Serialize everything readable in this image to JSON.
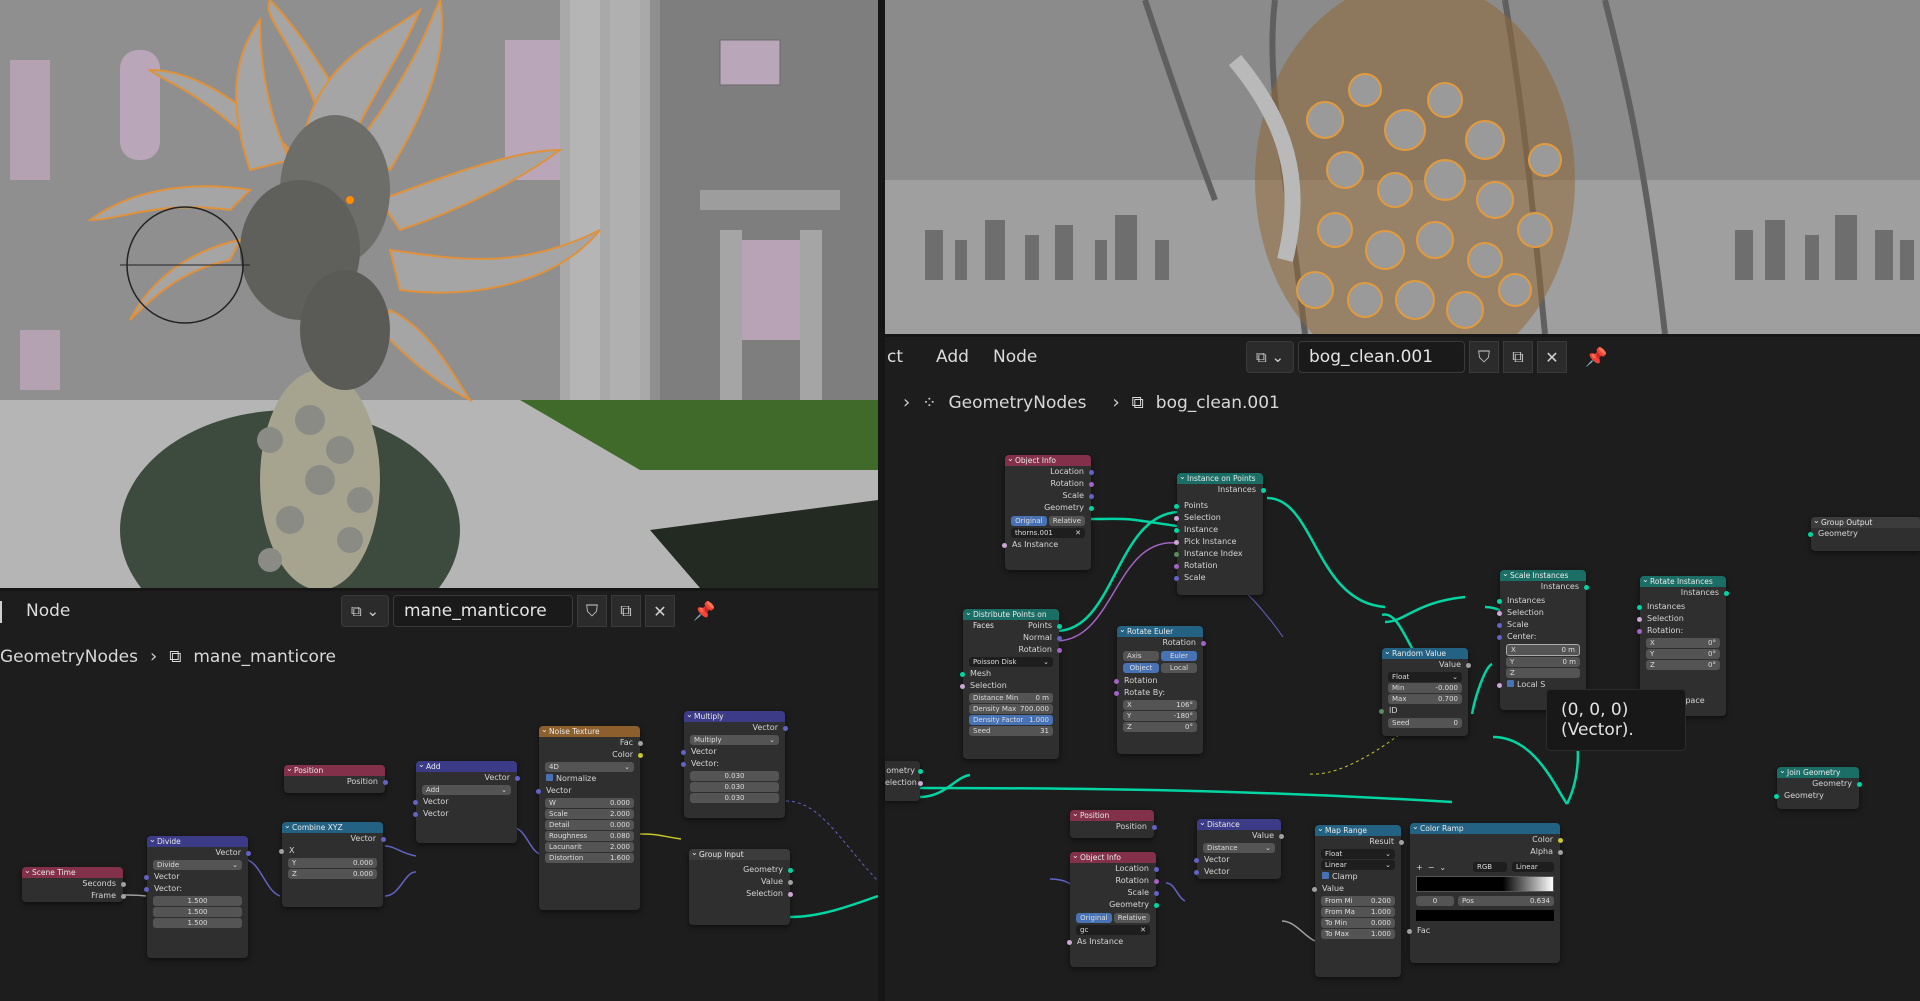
{
  "left_editor": {
    "menu": {
      "node": "Node"
    },
    "datablock": {
      "type_icon": "node-tree-icon",
      "name": "mane_manticore"
    },
    "breadcrumb": {
      "modifier": "GeometryNodes",
      "tree": "mane_manticore"
    },
    "nodes": {
      "scene_time": {
        "title": "Scene Time",
        "seconds": "Seconds",
        "frame": "Frame"
      },
      "divide": {
        "title": "Divide",
        "out": "Vector",
        "mode": "Divide",
        "in1": "Vector",
        "in2": "Vector:",
        "v": [
          "1.500",
          "1.500",
          "1.500"
        ]
      },
      "combine": {
        "title": "Combine XYZ",
        "out": "Vector",
        "x": "X",
        "y": "Y",
        "y_val": "0.000",
        "z": "Z",
        "z_val": "0.000"
      },
      "position": {
        "title": "Position",
        "out": "Position"
      },
      "add": {
        "title": "Add",
        "out": "Vector",
        "mode": "Add",
        "in1": "Vector",
        "in2": "Vector"
      },
      "noise": {
        "title": "Noise Texture",
        "fac": "Fac",
        "color": "Color",
        "dim": "4D",
        "normalize": "Normalize",
        "vector": "Vector",
        "w": "W",
        "w_val": "0.000",
        "scale": "Scale",
        "scale_val": "2.000",
        "detail": "Detail",
        "detail_val": "0.000",
        "rough": "Roughness",
        "rough_val": "0.080",
        "lac": "Lacunarit",
        "lac_val": "2.000",
        "dist": "Distortion",
        "dist_val": "1.600"
      },
      "multiply": {
        "title": "Multiply",
        "out": "Vector",
        "mode": "Multiply",
        "in1": "Vector",
        "in2": "Vector:",
        "v": [
          "0.030",
          "0.030",
          "0.030"
        ]
      },
      "group_input": {
        "title": "Group Input",
        "geometry": "Geometry",
        "value": "Value",
        "selection": "Selection"
      }
    }
  },
  "right_editor": {
    "menu": {
      "partial": "ct",
      "add": "Add",
      "node": "Node"
    },
    "datablock": {
      "type_icon": "node-tree-icon",
      "name": "bog_clean.001"
    },
    "breadcrumb": {
      "modifier": "GeometryNodes",
      "tree": "bog_clean.001"
    },
    "tooltip": "(0, 0, 0) (Vector).",
    "nodes": {
      "object_info": {
        "title": "Object Info",
        "location": "Location",
        "rotation": "Rotation",
        "scale": "Scale",
        "geometry": "Geometry",
        "original": "Original",
        "relative": "Relative",
        "object": "thorns.001",
        "as_instance": "As Instance"
      },
      "instance_on_points": {
        "title": "Instance on Points",
        "instances": "Instances",
        "points": "Points",
        "selection": "Selection",
        "instance": "Instance",
        "pick": "Pick Instance",
        "index": "Instance Index",
        "rotation": "Rotation",
        "scale": "Scale"
      },
      "distribute": {
        "title": "Distribute Points on Faces",
        "points": "Points",
        "normal": "Normal",
        "rotation": "Rotation",
        "mode": "Poisson Disk",
        "mesh": "Mesh",
        "selection": "Selection",
        "dist_min": "Distance Min",
        "dist_min_val": "0 m",
        "dens_max": "Density Max",
        "dens_max_val": "700.000",
        "dens_fac": "Density Factor",
        "dens_fac_val": "1.000",
        "seed": "Seed",
        "seed_val": "31"
      },
      "rotate_euler": {
        "title": "Rotate Euler",
        "rotation": "Rotation",
        "axis": "Axis An...",
        "euler": "Euler",
        "object": "Object",
        "local": "Local",
        "rot_in": "Rotation",
        "rot_by": "Rotate By:",
        "x": "X",
        "x_val": "106°",
        "y": "Y",
        "y_val": "-180°",
        "z": "Z",
        "z_val": "0°"
      },
      "scale_instances": {
        "title": "Scale Instances",
        "instances_out": "Instances",
        "instances": "Instances",
        "selection": "Selection",
        "scale": "Scale",
        "center": "Center:",
        "x": "X",
        "x_val": "0 m",
        "y": "Y",
        "y_val": "0 m",
        "z": "Z",
        "local": "Local S"
      },
      "rotate_instances": {
        "title": "Rotate Instances",
        "instances_out": "Instances",
        "instances": "Instances",
        "selection": "Selection",
        "rotation": "Rotation:",
        "x": "X",
        "x_val": "0°",
        "y": "Y",
        "y_val": "0°",
        "z": "Z",
        "z_val": "0°",
        "local": "Local Space"
      },
      "random_value": {
        "title": "Random Value",
        "value": "Value",
        "type": "Float",
        "min": "Min",
        "min_val": "-0.000",
        "max": "Max",
        "max_val": "0.700",
        "id": "ID",
        "seed": "Seed",
        "seed_val": "0"
      },
      "group_output": {
        "title": "Group Output",
        "geometry": "Geometry"
      },
      "join_geometry": {
        "title": "Join Geometry",
        "geometry_out": "Geometry",
        "geometry": "Geometry"
      },
      "position": {
        "title": "Position",
        "out": "Position"
      },
      "distance": {
        "title": "Distance",
        "value": "Value",
        "mode": "Distance",
        "in1": "Vector",
        "in2": "Vector"
      },
      "object_info2": {
        "title": "Object Info",
        "location": "Location",
        "rotation": "Rotation",
        "scale": "Scale",
        "geometry": "Geometry",
        "original": "Original",
        "relative": "Relative",
        "object": "gc",
        "as_instance": "As Instance"
      },
      "map_range": {
        "title": "Map Range",
        "result": "Result",
        "type": "Float",
        "interp": "Linear",
        "clamp": "Clamp",
        "value": "Value",
        "from_min": "From Mi",
        "from_min_val": "0.200",
        "from_max": "From Ma",
        "from_max_val": "1.000",
        "to_min": "To Min",
        "to_min_val": "0.000",
        "to_max": "To Max",
        "to_max_val": "1.000"
      },
      "color_ramp": {
        "title": "Color Ramp",
        "color": "Color",
        "alpha": "Alpha",
        "mode": "RGB",
        "interp": "Linear",
        "stop": "0",
        "pos": "Pos",
        "pos_val": "0.634",
        "fac": "Fac"
      },
      "group_input_partial": {
        "geometry": "ometry",
        "selection": "election"
      }
    }
  }
}
